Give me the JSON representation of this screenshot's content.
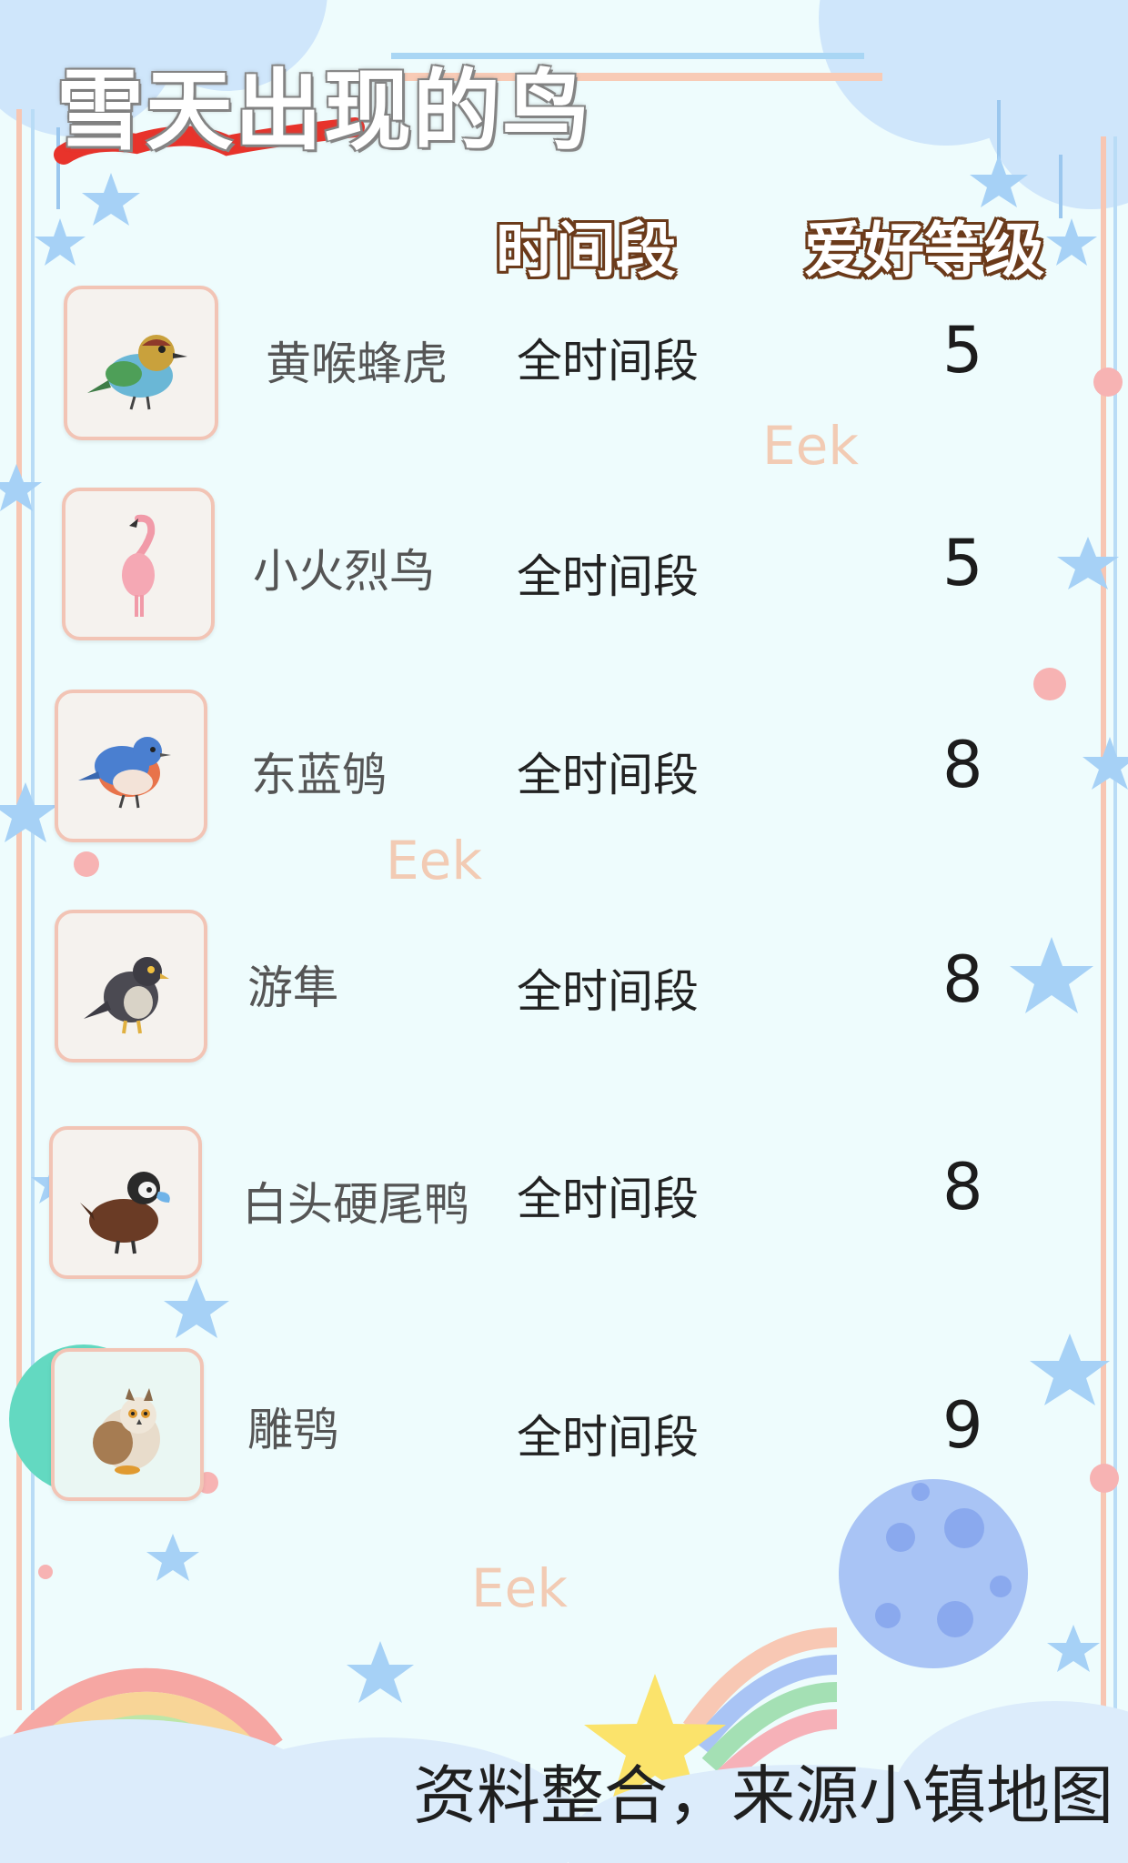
{
  "title": "雪天出现的鸟",
  "columns": {
    "time": "时间段",
    "level": "爱好等级"
  },
  "birds": [
    {
      "name": "黄喉蜂虎",
      "time": "全时间段",
      "level": "5",
      "icon": "bee-eater-bird-icon"
    },
    {
      "name": "小火烈鸟",
      "time": "全时间段",
      "level": "5",
      "icon": "flamingo-icon"
    },
    {
      "name": "东蓝鸲",
      "time": "全时间段",
      "level": "8",
      "icon": "bluebird-icon"
    },
    {
      "name": "游隼",
      "time": "全时间段",
      "level": "8",
      "icon": "falcon-icon"
    },
    {
      "name": "白头硬尾鸭",
      "time": "全时间段",
      "level": "8",
      "icon": "duck-icon"
    },
    {
      "name": "雕鸮",
      "time": "全时间段",
      "level": "9",
      "icon": "owl-icon"
    }
  ],
  "watermarks": [
    "Eek",
    "Eek",
    "Eek"
  ],
  "footer": "资料整合，来源小镇地图",
  "colors": {
    "background": "#eefcfd",
    "title_underline": "#e8332b",
    "header_outline": "#6b3a1a",
    "card_border": "#f2c4b5",
    "watermark": "#f3c3a8"
  }
}
